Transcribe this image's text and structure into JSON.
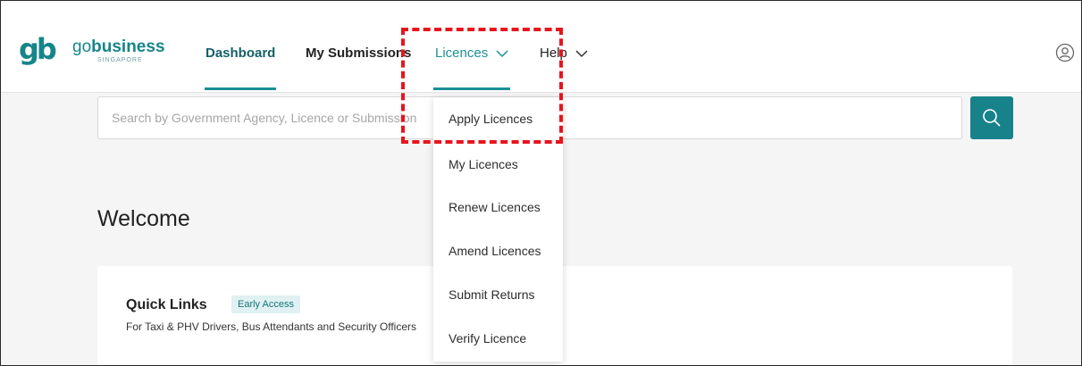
{
  "brand": {
    "mark": "gb",
    "word_go": "go",
    "word_business": "business",
    "subtitle": "SINGAPORE",
    "color": "#16858a"
  },
  "nav": {
    "dashboard": "Dashboard",
    "submissions": "My Submissions",
    "licences": "Licences",
    "help": "Help",
    "active_color": "#1b8f96"
  },
  "search": {
    "placeholder": "Search by Government Agency, Licence or Submission"
  },
  "licences_menu": {
    "items": [
      "Apply Licences",
      "My Licences",
      "Renew Licences",
      "Amend Licences",
      "Submit Returns",
      "Verify Licence"
    ]
  },
  "main": {
    "welcome": "Welcome",
    "quick_links": {
      "title": "Quick Links",
      "badge": "Early Access",
      "description": "For Taxi & PHV Drivers, Bus Attendants and Security Officers"
    }
  },
  "annotation": {
    "color": "#e8141c"
  }
}
